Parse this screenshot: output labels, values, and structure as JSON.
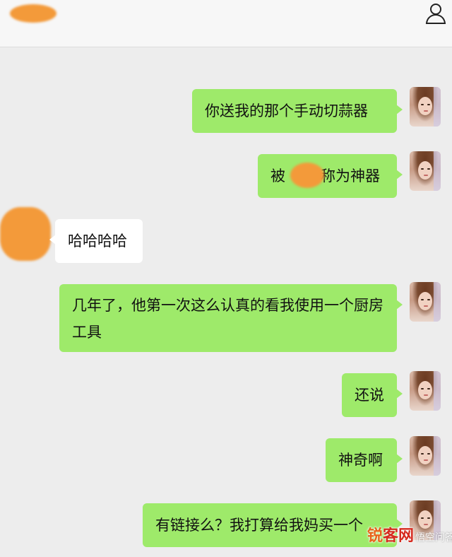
{
  "header": {
    "contact_name": "",
    "profile_icon": "person-icon"
  },
  "messages": [
    {
      "side": "me",
      "text": "你送我的那个手动切蒜器"
    },
    {
      "side": "me",
      "text_before": "被",
      "text_after": "称为神器"
    },
    {
      "side": "them",
      "text": "哈哈哈哈"
    },
    {
      "side": "me",
      "text": "几年了，他第一次这么认真的看我使用一个厨房工具"
    },
    {
      "side": "me",
      "text": "还说"
    },
    {
      "side": "me",
      "text": "神奇啊"
    },
    {
      "side": "me",
      "text": "有链接么？我打算给我妈买一个"
    }
  ],
  "watermark": {
    "part1": "锐",
    "part2": "客网",
    "part3": "悟空问答"
  },
  "colors": {
    "my_bubble": "#9eea6a",
    "their_bubble": "#ffffff",
    "background": "#ededed",
    "redaction": "#f39a3a"
  }
}
